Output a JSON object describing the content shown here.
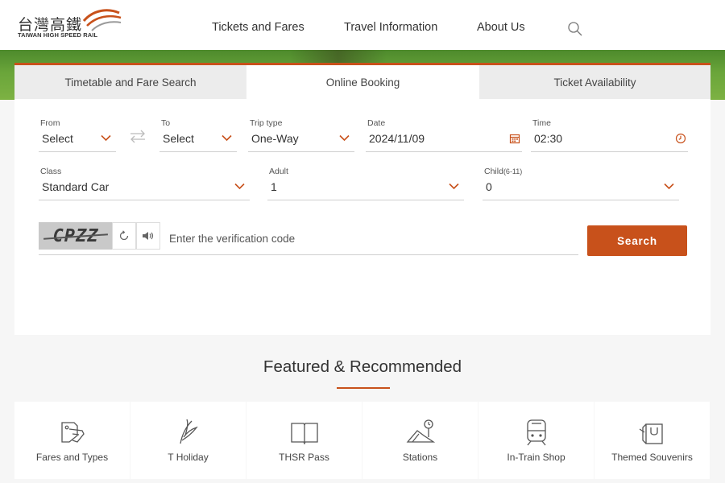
{
  "header": {
    "logo_cn": "台灣高鐵",
    "logo_en": "TAIWAN HIGH SPEED RAIL",
    "nav": [
      "Tickets and Fares",
      "Travel Information",
      "About Us"
    ],
    "search_icon": "search-icon"
  },
  "tabs": [
    {
      "label": "Timetable and Fare Search",
      "active": false
    },
    {
      "label": "Online Booking",
      "active": true
    },
    {
      "label": "Ticket Availability",
      "active": false
    }
  ],
  "booking": {
    "from": {
      "label": "From",
      "value": "Select"
    },
    "to": {
      "label": "To",
      "value": "Select"
    },
    "trip_type": {
      "label": "Trip type",
      "value": "One-Way"
    },
    "date": {
      "label": "Date",
      "value": "2024/11/09"
    },
    "time": {
      "label": "Time",
      "value": "02:30"
    },
    "class": {
      "label": "Class",
      "value": "Standard Car"
    },
    "adult": {
      "label": "Adult",
      "value": "1"
    },
    "child": {
      "label": "Child",
      "label_suffix": "(6-11)",
      "value": "0"
    },
    "captcha_text": "CPZZ",
    "verification_placeholder": "Enter the verification code",
    "search_button": "Search"
  },
  "featured": {
    "title": "Featured & Recommended",
    "items": [
      {
        "label": "Fares and Types",
        "icon": "ticket-icon"
      },
      {
        "label": "T Holiday",
        "icon": "leaf-icon"
      },
      {
        "label": "THSR Pass",
        "icon": "book-icon"
      },
      {
        "label": "Stations",
        "icon": "station-icon"
      },
      {
        "label": "In-Train Shop",
        "icon": "train-icon"
      },
      {
        "label": "Themed Souvenirs",
        "icon": "shopping-bag-icon"
      }
    ]
  },
  "colors": {
    "accent": "#c8511b",
    "tab_inactive": "#ececec",
    "banner_green": "#6aa53a"
  }
}
